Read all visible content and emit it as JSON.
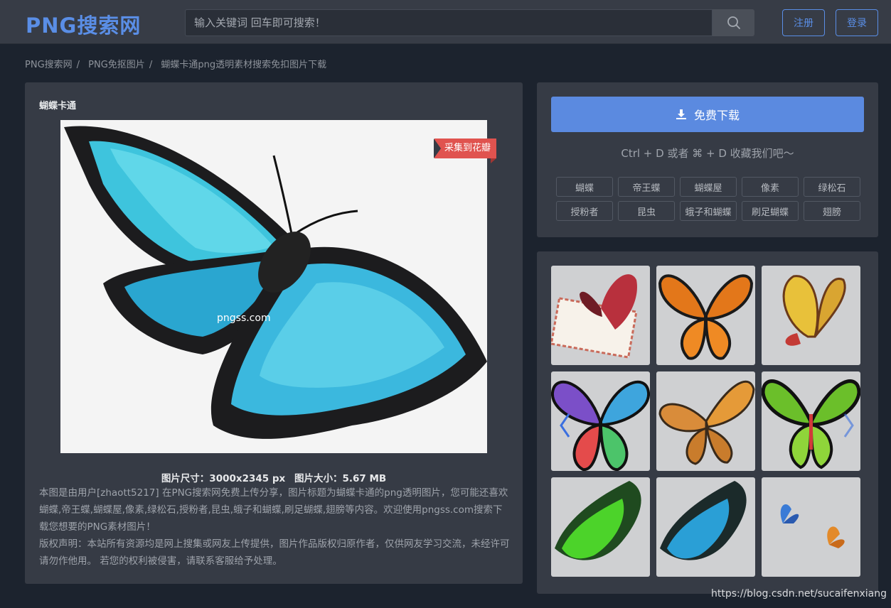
{
  "header": {
    "logo": "PNG搜索网",
    "search_placeholder": "输入关键词 回车即可搜索！",
    "register": "注册",
    "login": "登录"
  },
  "breadcrumb": {
    "items": [
      "PNG搜索网",
      "PNG免抠图片",
      "蝴蝶卡通png透明素材搜索免扣图片下载"
    ],
    "separator": "/"
  },
  "detail": {
    "title": "蝴蝶卡通",
    "ribbon": "采集到花瓣",
    "watermark_text": "pngss.com",
    "size_label": "图片尺寸：3000x2345 px",
    "filesize_label": "图片大小：5.67 MB",
    "description": "本图是由用户[zhaott5217] 在PNG搜索网免费上传分享，图片标题为蝴蝶卡通的png透明图片，您可能还喜欢蝴蝶,帝王蝶,蝴蝶屋,像素,绿松石,授粉者,昆虫,蛾子和蝴蝶,刷足蝴蝶,翅膀等内容。欢迎使用pngss.com搜索下载您想要的PNG素材图片！",
    "copyright": "版权声明：本站所有资源均是网上搜集或网友上传提供，图片作品版权归原作者，仅供网友学习交流，未经许可请勿作他用。 若您的权利被侵害，请联系客服给予处理。"
  },
  "side": {
    "download_label": "免费下载",
    "fav_tip": "Ctrl + D 或者 ⌘ + D 收藏我们吧～",
    "tags": [
      "蝴蝶",
      "帝王蝶",
      "蝴蝶屋",
      "像素",
      "绿松石",
      "授粉者",
      "昆虫",
      "蛾子和蝴蝶",
      "刷足蝴蝶",
      "翅膀"
    ]
  },
  "colors": {
    "accent": "#5b8ae0",
    "ribbon": "#e0534f",
    "background": "#1c232e",
    "panel": "#363b45"
  },
  "footer_watermark": "https://blog.csdn.net/sucaifenxiang"
}
